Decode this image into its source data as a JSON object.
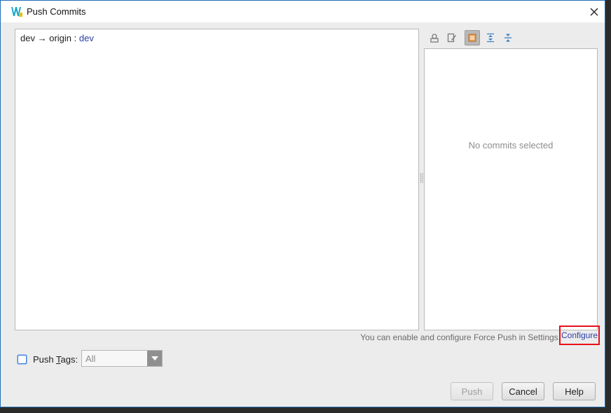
{
  "window": {
    "title": "Push Commits"
  },
  "push_tree": {
    "rows": [
      {
        "local_branch": "dev",
        "arrow": "→",
        "remote": "origin :",
        "remote_branch": "dev"
      }
    ]
  },
  "details": {
    "empty_text": "No commits selected"
  },
  "toolbar": {
    "icons": [
      "user-info-icon",
      "edit-details-icon",
      "show-details-icon",
      "expand-all-icon",
      "collapse-all-icon"
    ],
    "pressed": "show-details-icon"
  },
  "force_push": {
    "hint": "You can enable and configure Force Push in Settings.",
    "link_label": "Configure"
  },
  "push_tags": {
    "prefix": "Push ",
    "mnemonic": "T",
    "suffix": "ags:",
    "checked": false,
    "selected": "All"
  },
  "buttons": {
    "push": "Push",
    "cancel": "Cancel",
    "help": "Help"
  },
  "colors": {
    "link": "#2a3ea8",
    "highlight_box": "#e8101a",
    "pressed_toggle": "#b8b8b8"
  }
}
